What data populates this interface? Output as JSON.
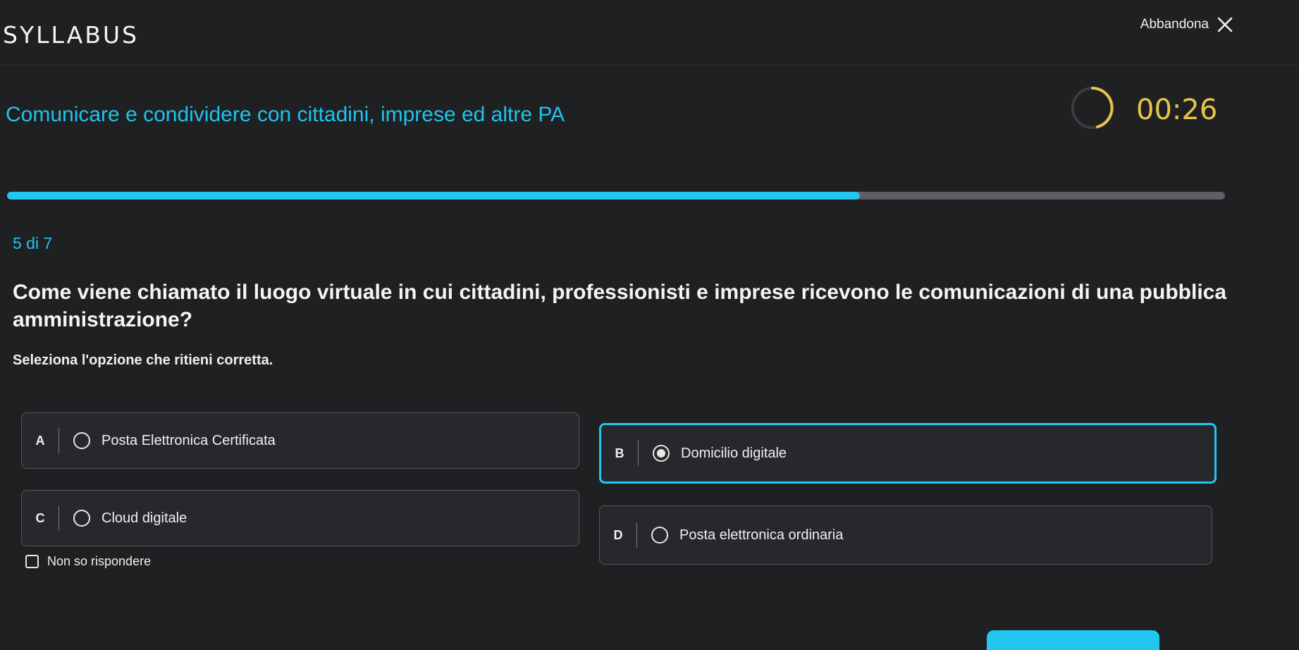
{
  "header": {
    "logo": "SYLLABUS",
    "quit_label": "Abbandona",
    "quit_icon": "close-icon"
  },
  "course": {
    "title": "Comunicare e condividere con cittadini, imprese ed altre PA"
  },
  "timer": {
    "text": "00:26",
    "icon": "timer-ring-icon",
    "color": "#e8c44a"
  },
  "progress": {
    "fraction": 0.7,
    "color": "#22c6ef"
  },
  "quiz": {
    "counter": "5 di 7",
    "question": "Come viene chiamato il luogo virtuale in cui cittadini, professionisti e imprese ricevono le comunicazioni di una pubblica amministrazione?",
    "instruction": "Seleziona l'opzione che ritieni corretta.",
    "options": [
      {
        "letter": "A",
        "label": "Posta Elettronica Certificata",
        "selected": false
      },
      {
        "letter": "B",
        "label": "Domicilio digitale",
        "selected": true
      },
      {
        "letter": "C",
        "label": "Cloud digitale",
        "selected": false
      },
      {
        "letter": "D",
        "label": "Posta elettronica ordinaria",
        "selected": false
      }
    ],
    "skip_label": "Non so rispondere",
    "skip_checked": false
  },
  "colors": {
    "accent": "#20c3ec",
    "background": "#1f2022"
  }
}
